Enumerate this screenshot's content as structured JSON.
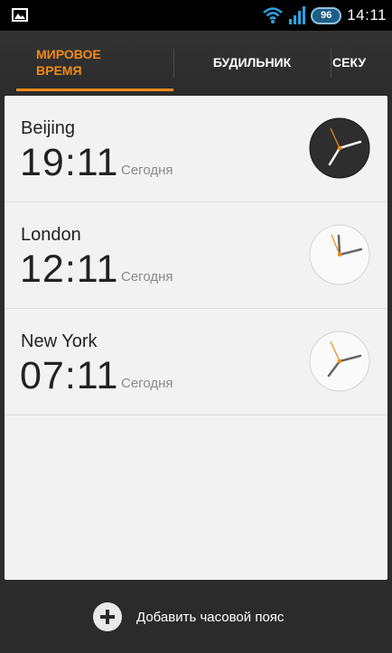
{
  "status_bar": {
    "left_icon": "gallery-icon",
    "wifi_icon": "wifi-icon",
    "signal_icon": "signal-icon",
    "battery_level": "96",
    "time": "14:11"
  },
  "tabs": [
    {
      "label": "МИРОВОЕ ВРЕМЯ",
      "active": true
    },
    {
      "label": "БУДИЛЬНИК",
      "active": false
    },
    {
      "label": "СЕКУ",
      "active": false
    }
  ],
  "colors": {
    "accent": "#f08a18"
  },
  "cities": [
    {
      "name": "Beijing",
      "time": "19:11",
      "day": "Сегодня",
      "clock_style": "dark"
    },
    {
      "name": "London",
      "time": "12:11",
      "day": "Сегодня",
      "clock_style": "light"
    },
    {
      "name": "New York",
      "time": "07:11",
      "day": "Сегодня",
      "clock_style": "light"
    }
  ],
  "bottom": {
    "add_icon": "plus-icon",
    "add_label": "Добавить часовой пояс"
  }
}
